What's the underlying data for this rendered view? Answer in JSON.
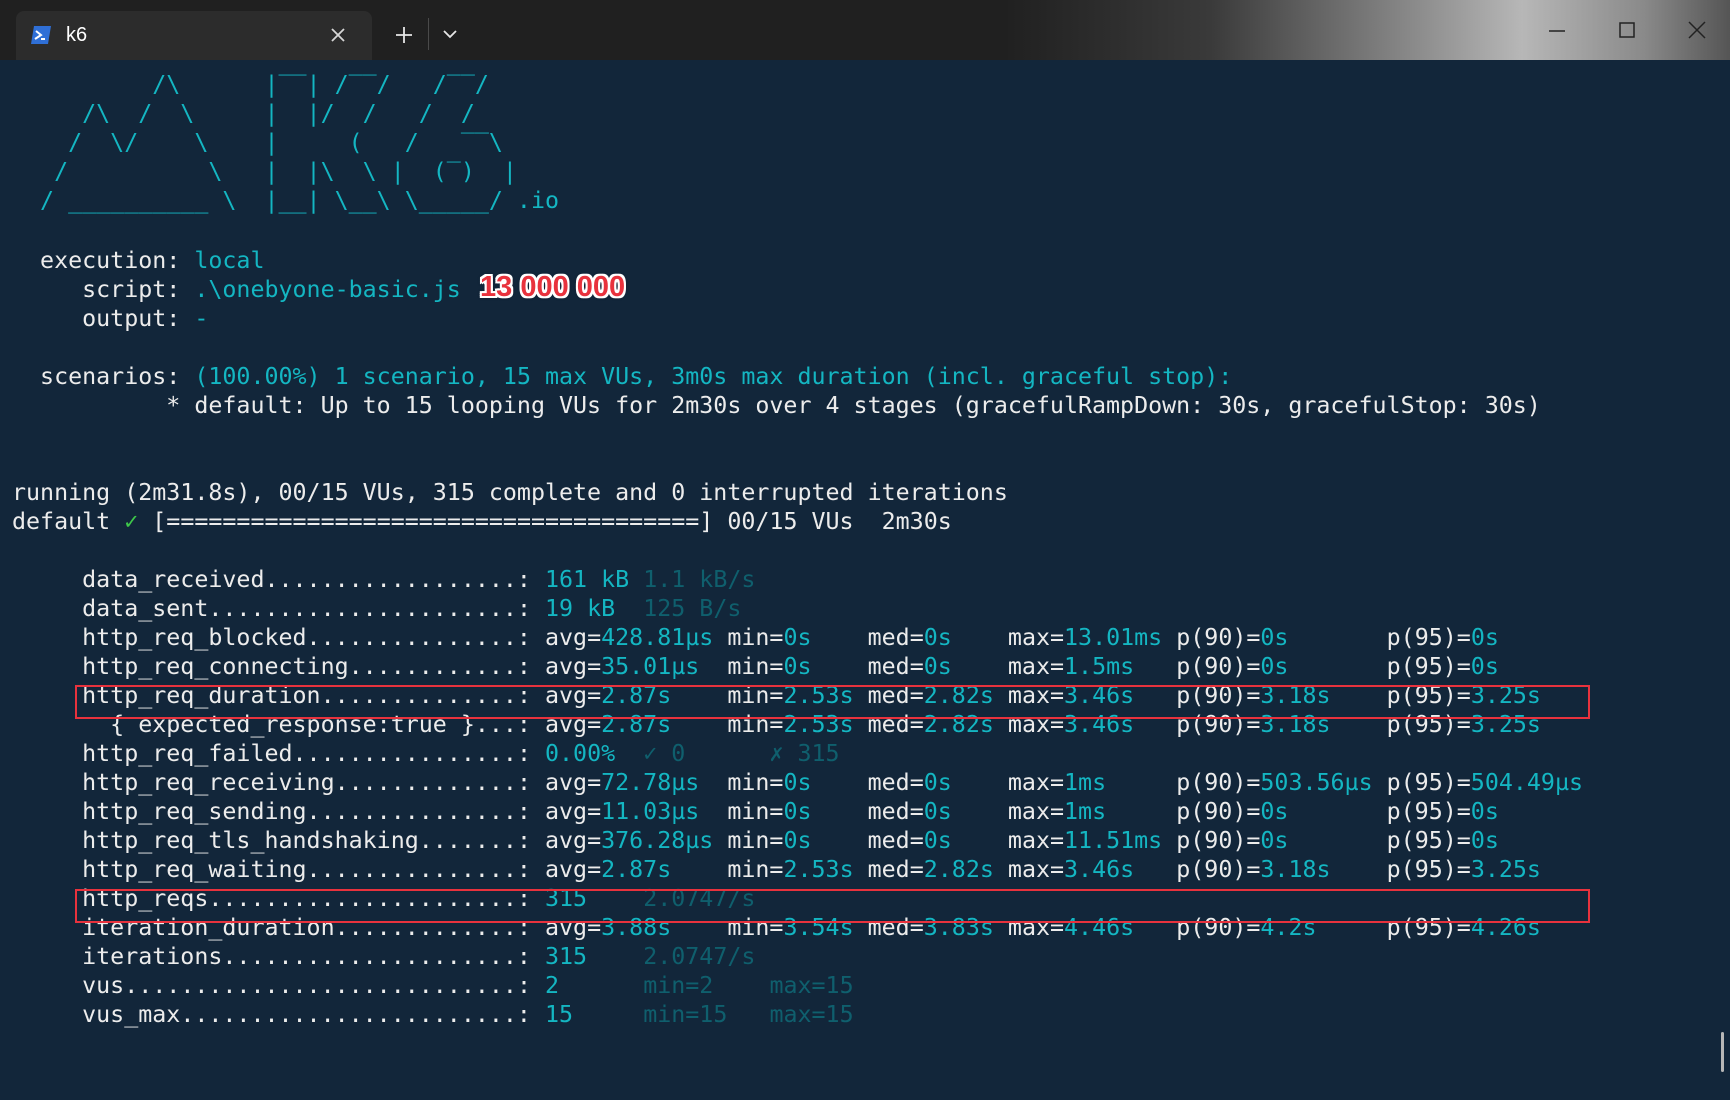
{
  "window": {
    "tab_title": "k6",
    "new_tab_glyph": "+",
    "icons": [
      "powershell-icon",
      "close-icon",
      "plus-icon",
      "chevron-down-icon",
      "minimize-icon",
      "maximize-icon",
      "window-close-icon"
    ]
  },
  "colors": {
    "background": "#12263a",
    "text": "#ececec",
    "cyan": "#14b6c2",
    "cyan_dim": "#0f5f6d",
    "check_green": "#3ec84a",
    "highlight_box": "#e8323d"
  },
  "logo": [
    "          /\\      |‾‾| /‾‾/   /‾‾/",
    "     /\\  /  \\     |  |/  /   /  /",
    "    /  \\/    \\    |     (   /   ‾‾\\",
    "   /          \\   |  |\\  \\ |  (‾)  |",
    "  / __________ \\  |__| \\__\\ \\_____/ .io"
  ],
  "execution": {
    "execution_label": "  execution: ",
    "execution_value": "local",
    "script_label": "     script: ",
    "script_value": ".\\onebyone-basic.js",
    "output_label": "     output: ",
    "output_value": "-"
  },
  "annotation": "13 000 000",
  "scenarios": {
    "label": "  scenarios: ",
    "summary": "(100.00%) 1 scenario, 15 max VUs, 3m0s max duration (incl. graceful stop):",
    "detail": "           * default: Up to 15 looping VUs for 2m30s over 4 stages (gracefulRampDown: 30s, gracefulStop: 30s)"
  },
  "status": {
    "running_line": "running (2m31.8s), 00/15 VUs, 315 complete and 0 interrupted iterations",
    "default_prefix": "default ",
    "check_mark": "✓",
    "progress": " [======================================] 00/15 VUs  2m30s"
  },
  "metrics": [
    {
      "name": "data_received",
      "parts": [
        [
          "c",
          "161 kB"
        ],
        [
          "w",
          " "
        ],
        [
          "cd",
          "1.1 kB/s"
        ]
      ]
    },
    {
      "name": "data_sent",
      "parts": [
        [
          "c",
          "19 kB"
        ],
        [
          "w",
          "  "
        ],
        [
          "cd",
          "125 B/s"
        ]
      ]
    },
    {
      "name": "http_req_blocked",
      "parts": [
        [
          "w",
          "avg="
        ],
        [
          "c",
          "428.81µs"
        ],
        [
          "w",
          " min="
        ],
        [
          "c",
          "0s"
        ],
        [
          "w",
          "    med="
        ],
        [
          "c",
          "0s"
        ],
        [
          "w",
          "    max="
        ],
        [
          "c",
          "13.01ms"
        ],
        [
          "w",
          " p(90)="
        ],
        [
          "c",
          "0s"
        ],
        [
          "w",
          "       p(95)="
        ],
        [
          "c",
          "0s"
        ]
      ]
    },
    {
      "name": "http_req_connecting",
      "parts": [
        [
          "w",
          "avg="
        ],
        [
          "c",
          "35.01µs"
        ],
        [
          "w",
          "  min="
        ],
        [
          "c",
          "0s"
        ],
        [
          "w",
          "    med="
        ],
        [
          "c",
          "0s"
        ],
        [
          "w",
          "    max="
        ],
        [
          "c",
          "1.5ms"
        ],
        [
          "w",
          "   p(90)="
        ],
        [
          "c",
          "0s"
        ],
        [
          "w",
          "       p(95)="
        ],
        [
          "c",
          "0s"
        ]
      ]
    },
    {
      "name": "http_req_duration",
      "highlight": true,
      "parts": [
        [
          "w",
          "avg="
        ],
        [
          "c",
          "2.87s"
        ],
        [
          "w",
          "    min="
        ],
        [
          "c",
          "2.53s"
        ],
        [
          "w",
          " med="
        ],
        [
          "c",
          "2.82s"
        ],
        [
          "w",
          " max="
        ],
        [
          "c",
          "3.46s"
        ],
        [
          "w",
          "   p(90)="
        ],
        [
          "c",
          "3.18s"
        ],
        [
          "w",
          "    p(95)="
        ],
        [
          "c",
          "3.25s"
        ]
      ]
    },
    {
      "name": "  { expected_response:true }",
      "parts": [
        [
          "w",
          "avg="
        ],
        [
          "c",
          "2.87s"
        ],
        [
          "w",
          "    min="
        ],
        [
          "c",
          "2.53s"
        ],
        [
          "w",
          " med="
        ],
        [
          "c",
          "2.82s"
        ],
        [
          "w",
          " max="
        ],
        [
          "c",
          "3.46s"
        ],
        [
          "w",
          "   p(90)="
        ],
        [
          "c",
          "3.18s"
        ],
        [
          "w",
          "    p(95)="
        ],
        [
          "c",
          "3.25s"
        ]
      ]
    },
    {
      "name": "http_req_failed",
      "parts": [
        [
          "c",
          "0.00%"
        ],
        [
          "w",
          "  "
        ],
        [
          "cd",
          "✓ 0"
        ],
        [
          "w",
          "      "
        ],
        [
          "cd",
          "✗ 315"
        ]
      ]
    },
    {
      "name": "http_req_receiving",
      "parts": [
        [
          "w",
          "avg="
        ],
        [
          "c",
          "72.78µs"
        ],
        [
          "w",
          "  min="
        ],
        [
          "c",
          "0s"
        ],
        [
          "w",
          "    med="
        ],
        [
          "c",
          "0s"
        ],
        [
          "w",
          "    max="
        ],
        [
          "c",
          "1ms"
        ],
        [
          "w",
          "     p(90)="
        ],
        [
          "c",
          "503.56µs"
        ],
        [
          "w",
          " p(95)="
        ],
        [
          "c",
          "504.49µs"
        ]
      ]
    },
    {
      "name": "http_req_sending",
      "parts": [
        [
          "w",
          "avg="
        ],
        [
          "c",
          "11.03µs"
        ],
        [
          "w",
          "  min="
        ],
        [
          "c",
          "0s"
        ],
        [
          "w",
          "    med="
        ],
        [
          "c",
          "0s"
        ],
        [
          "w",
          "    max="
        ],
        [
          "c",
          "1ms"
        ],
        [
          "w",
          "     p(90)="
        ],
        [
          "c",
          "0s"
        ],
        [
          "w",
          "       p(95)="
        ],
        [
          "c",
          "0s"
        ]
      ]
    },
    {
      "name": "http_req_tls_handshaking",
      "parts": [
        [
          "w",
          "avg="
        ],
        [
          "c",
          "376.28µs"
        ],
        [
          "w",
          " min="
        ],
        [
          "c",
          "0s"
        ],
        [
          "w",
          "    med="
        ],
        [
          "c",
          "0s"
        ],
        [
          "w",
          "    max="
        ],
        [
          "c",
          "11.51ms"
        ],
        [
          "w",
          " p(90)="
        ],
        [
          "c",
          "0s"
        ],
        [
          "w",
          "       p(95)="
        ],
        [
          "c",
          "0s"
        ]
      ]
    },
    {
      "name": "http_req_waiting",
      "parts": [
        [
          "w",
          "avg="
        ],
        [
          "c",
          "2.87s"
        ],
        [
          "w",
          "    min="
        ],
        [
          "c",
          "2.53s"
        ],
        [
          "w",
          " med="
        ],
        [
          "c",
          "2.82s"
        ],
        [
          "w",
          " max="
        ],
        [
          "c",
          "3.46s"
        ],
        [
          "w",
          "   p(90)="
        ],
        [
          "c",
          "3.18s"
        ],
        [
          "w",
          "    p(95)="
        ],
        [
          "c",
          "3.25s"
        ]
      ]
    },
    {
      "name": "http_reqs",
      "highlight": true,
      "parts": [
        [
          "c",
          "315"
        ],
        [
          "w",
          "    "
        ],
        [
          "cd",
          "2.0747/s"
        ]
      ]
    },
    {
      "name": "iteration_duration",
      "parts": [
        [
          "w",
          "avg="
        ],
        [
          "c",
          "3.88s"
        ],
        [
          "w",
          "    min="
        ],
        [
          "c",
          "3.54s"
        ],
        [
          "w",
          " med="
        ],
        [
          "c",
          "3.83s"
        ],
        [
          "w",
          " max="
        ],
        [
          "c",
          "4.46s"
        ],
        [
          "w",
          "   p(90)="
        ],
        [
          "c",
          "4.2s"
        ],
        [
          "w",
          "     p(95)="
        ],
        [
          "c",
          "4.26s"
        ]
      ]
    },
    {
      "name": "iterations",
      "parts": [
        [
          "c",
          "315"
        ],
        [
          "w",
          "    "
        ],
        [
          "cd",
          "2.0747/s"
        ]
      ]
    },
    {
      "name": "vus",
      "parts": [
        [
          "c",
          "2"
        ],
        [
          "w",
          "      "
        ],
        [
          "cd",
          "min=2"
        ],
        [
          "w",
          "    "
        ],
        [
          "cd",
          "max=15"
        ]
      ]
    },
    {
      "name": "vus_max",
      "parts": [
        [
          "c",
          "15"
        ],
        [
          "w",
          "     "
        ],
        [
          "cd",
          "min=15"
        ],
        [
          "w",
          "   "
        ],
        [
          "cd",
          "max=15"
        ]
      ]
    }
  ]
}
